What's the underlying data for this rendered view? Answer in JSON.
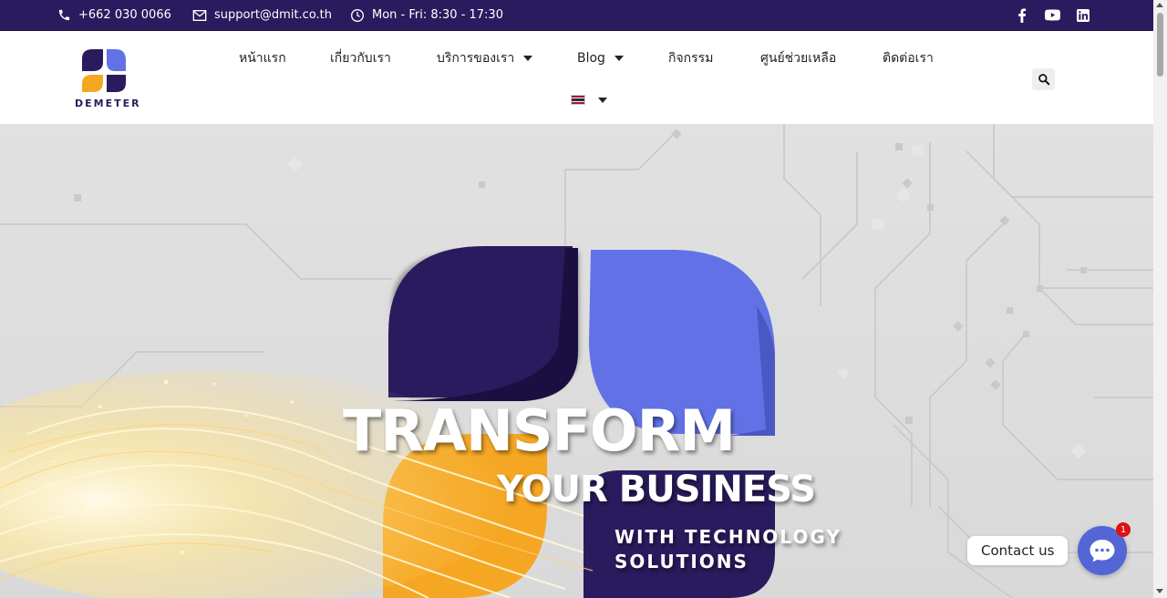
{
  "topbar": {
    "phone": "+662 030 0066",
    "email": "support@dmit.co.th",
    "hours": "Mon - Fri: 8:30 - 17:30",
    "social_icons": [
      "facebook-icon",
      "youtube-icon",
      "linkedin-icon"
    ]
  },
  "brand": {
    "logo_text": "DEMETER",
    "colors": {
      "navy": "#2a1b5e",
      "blue": "#6272e6",
      "orange": "#f5a623"
    }
  },
  "nav": {
    "items": [
      {
        "label": "หน้าแรก",
        "dropdown": false
      },
      {
        "label": "เกี่ยวกับเรา",
        "dropdown": false
      },
      {
        "label": "บริการของเรา",
        "dropdown": true
      },
      {
        "label": "Blog",
        "dropdown": true
      },
      {
        "label": "กิจกรรม",
        "dropdown": false
      },
      {
        "label": "ศูนย์ช่วยเหลือ",
        "dropdown": false
      },
      {
        "label": "ติดต่อเรา",
        "dropdown": false
      }
    ],
    "language": "th"
  },
  "hero": {
    "line1": "TRANSFORM",
    "line2": "YOUR BUSINESS",
    "line3a": "WITH TECHNOLOGY",
    "line3b": "SOLUTIONS"
  },
  "contact": {
    "label": "Contact us",
    "badge_count": "1",
    "accent": "#5466d6"
  }
}
